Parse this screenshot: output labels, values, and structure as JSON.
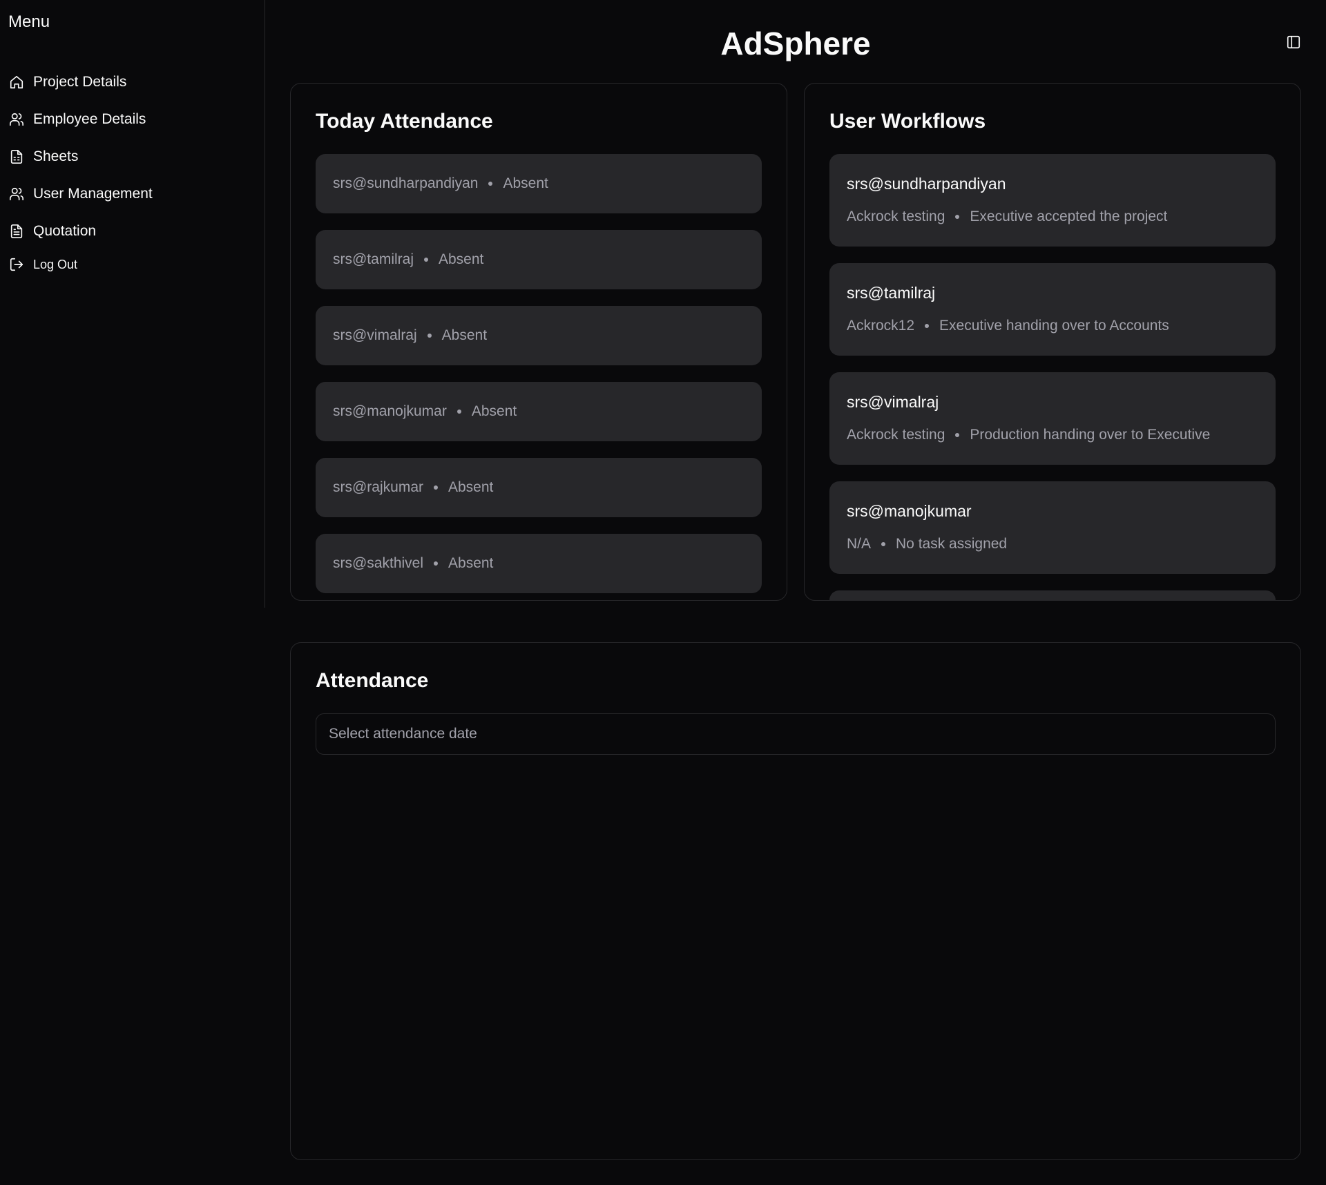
{
  "sidebar": {
    "title": "Menu",
    "items": [
      {
        "label": "Project Details",
        "icon": "home-icon"
      },
      {
        "label": "Employee Details",
        "icon": "users-icon"
      },
      {
        "label": "Sheets",
        "icon": "sheet-icon"
      },
      {
        "label": "User Management",
        "icon": "users-icon"
      },
      {
        "label": "Quotation",
        "icon": "document-icon"
      },
      {
        "label": "Log Out",
        "icon": "logout-icon"
      }
    ]
  },
  "header": {
    "title": "AdSphere",
    "toggle_icon": "sidebar-toggle-icon"
  },
  "today_attendance": {
    "title": "Today Attendance",
    "items": [
      {
        "user": "srs@sundharpandiyan",
        "status": "Absent"
      },
      {
        "user": "srs@tamilraj",
        "status": "Absent"
      },
      {
        "user": "srs@vimalraj",
        "status": "Absent"
      },
      {
        "user": "srs@manojkumar",
        "status": "Absent"
      },
      {
        "user": "srs@rajkumar",
        "status": "Absent"
      },
      {
        "user": "srs@sakthivel",
        "status": "Absent"
      }
    ]
  },
  "user_workflows": {
    "title": "User Workflows",
    "items": [
      {
        "user": "srs@sundharpandiyan",
        "project": "Ackrock testing",
        "status": "Executive accepted the project"
      },
      {
        "user": "srs@tamilraj",
        "project": "Ackrock12",
        "status": "Executive handing over to Accounts"
      },
      {
        "user": "srs@vimalraj",
        "project": "Ackrock testing",
        "status": "Production handing over to Executive"
      },
      {
        "user": "srs@manojkumar",
        "project": "N/A",
        "status": "No task assigned"
      }
    ]
  },
  "attendance": {
    "title": "Attendance",
    "date_placeholder": "Select attendance date"
  },
  "colors": {
    "background": "#09090b",
    "card_item": "#27272a",
    "border": "#27272a",
    "muted_text": "#a1a1aa",
    "text": "#fafafa"
  }
}
